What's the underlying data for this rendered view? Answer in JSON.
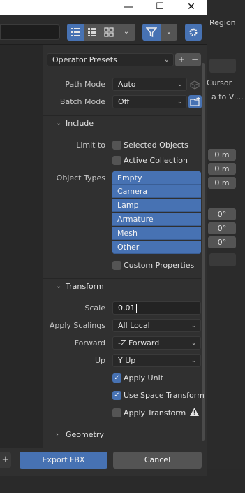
{
  "background": {
    "region_label": "Region",
    "cursor_label": "Cursor",
    "to_view_label": "a to Vi...",
    "location_values": [
      "0 m",
      "0 m",
      "0 m"
    ],
    "rotation_values": [
      "0°",
      "0°",
      "0°"
    ]
  },
  "window": {
    "minimize_glyph": "—",
    "maximize_glyph": "☐",
    "close_glyph": "✕"
  },
  "toolbar": {
    "view_list_icon": "list-view-icon",
    "view_thumb_small_icon": "small-thumbnail-icon",
    "view_thumb_large_icon": "large-thumbnail-icon",
    "filter_icon": "funnel-icon",
    "settings_icon": "gear-icon"
  },
  "presets": {
    "label": "Operator Presets",
    "add": "+",
    "remove": "−"
  },
  "main": {
    "path_mode_label": "Path Mode",
    "path_mode_value": "Auto",
    "batch_mode_label": "Batch Mode",
    "batch_mode_value": "Off"
  },
  "include": {
    "title": "Include",
    "limit_to_label": "Limit to",
    "selected_objects": "Selected Objects",
    "active_collection": "Active Collection",
    "object_types_label": "Object Types",
    "object_types": [
      "Empty",
      "Camera",
      "Lamp",
      "Armature",
      "Mesh",
      "Other"
    ],
    "custom_properties": "Custom Properties"
  },
  "transform": {
    "title": "Transform",
    "scale_label": "Scale",
    "scale_value": "0.01",
    "apply_scalings_label": "Apply Scalings",
    "apply_scalings_value": "All Local",
    "forward_label": "Forward",
    "forward_value": "-Z Forward",
    "up_label": "Up",
    "up_value": "Y Up",
    "apply_unit": "Apply Unit",
    "use_space_transform": "Use Space Transform",
    "apply_transform": "Apply Transform"
  },
  "geometry": {
    "title": "Geometry"
  },
  "footer": {
    "export_label": "Export FBX",
    "cancel_label": "Cancel",
    "plus_label": "+"
  }
}
